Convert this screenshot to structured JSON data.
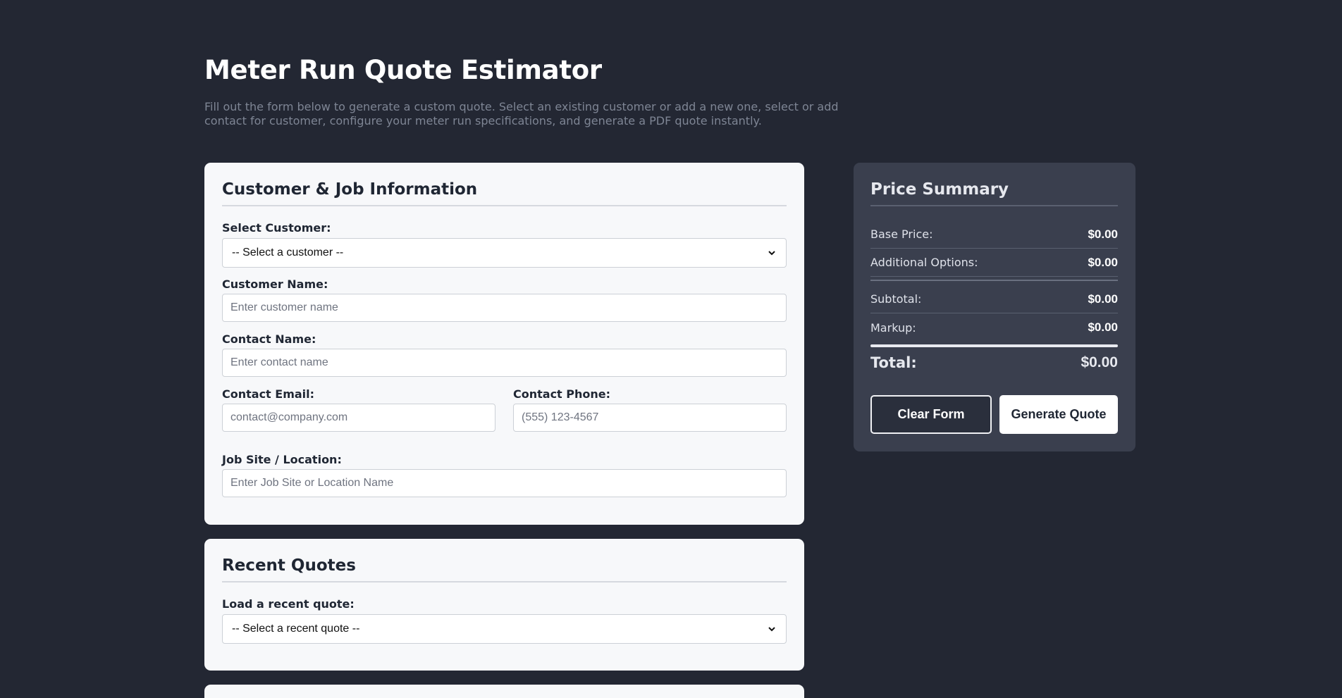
{
  "header": {
    "title": "Meter Run Quote Estimator",
    "description": "Fill out the form below to generate a custom quote. Select an existing customer or add a new one, select or add contact for customer, configure your meter run specifications, and generate a PDF quote instantly."
  },
  "customer_section": {
    "title": "Customer & Job Information",
    "select_customer_label": "Select Customer:",
    "select_customer_value": "-- Select a customer --",
    "customer_name_label": "Customer Name:",
    "customer_name_placeholder": "Enter customer name",
    "contact_name_label": "Contact Name:",
    "contact_name_placeholder": "Enter contact name",
    "contact_email_label": "Contact Email:",
    "contact_email_placeholder": "contact@company.com",
    "contact_phone_label": "Contact Phone:",
    "contact_phone_placeholder": "(555) 123-4567",
    "job_site_label": "Job Site / Location:",
    "job_site_placeholder": "Enter Job Site or Location Name"
  },
  "recent_quotes": {
    "title": "Recent Quotes",
    "load_label": "Load a recent quote:",
    "select_value": "-- Select a recent quote --"
  },
  "price_summary": {
    "title": "Price Summary",
    "base_price_label": "Base Price:",
    "base_price_value": "$0.00",
    "additional_options_label": "Additional Options:",
    "additional_options_value": "$0.00",
    "subtotal_label": "Subtotal:",
    "subtotal_value": "$0.00",
    "markup_label": "Markup:",
    "markup_value": "$0.00",
    "total_label": "Total:",
    "total_value": "$0.00",
    "clear_button": "Clear Form",
    "generate_button": "Generate Quote"
  },
  "colors": {
    "background": "#232733",
    "card": "#f7f8fa",
    "summary_panel": "#3a3f4e",
    "text_dark": "#1f2633"
  }
}
